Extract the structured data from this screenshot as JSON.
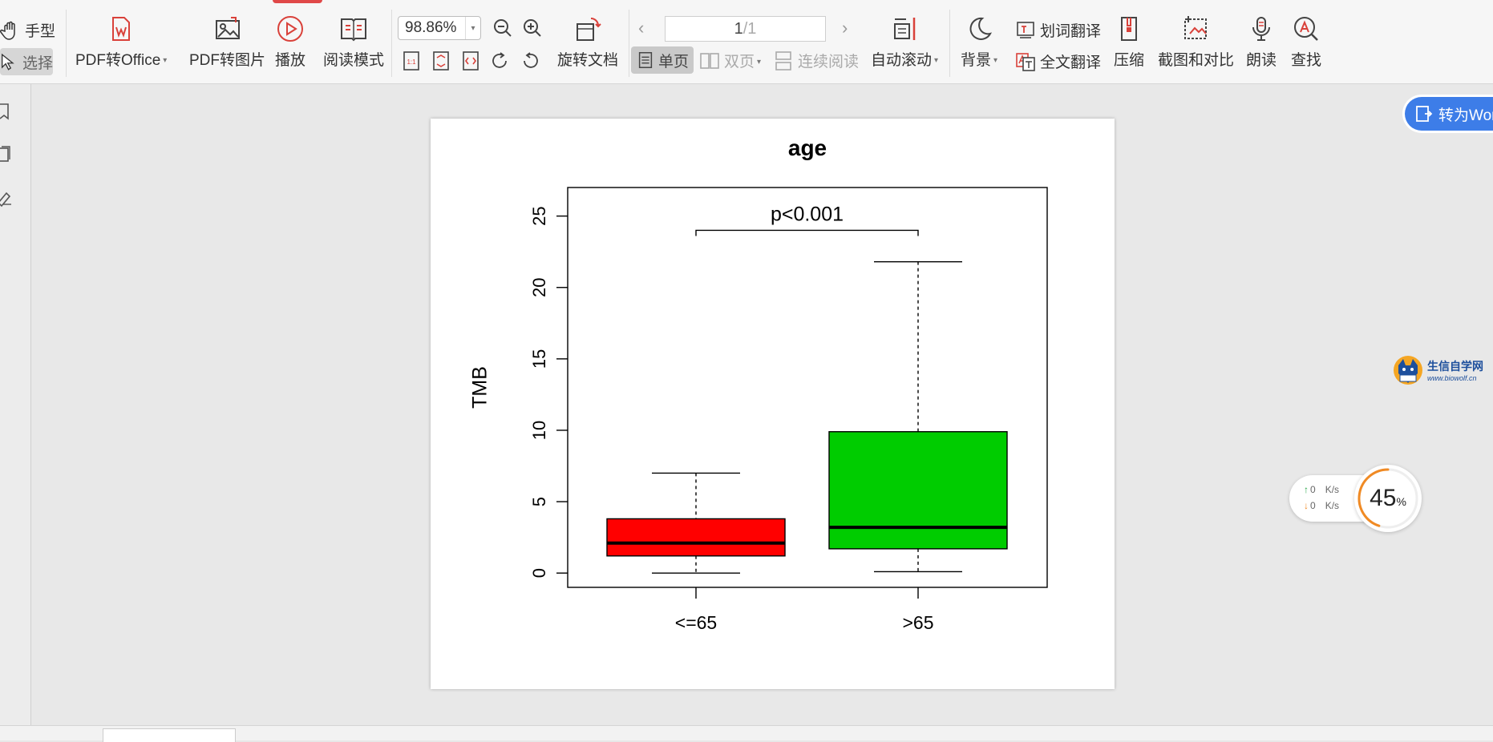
{
  "toolbar": {
    "hand_label": "手型",
    "select_label": "选择",
    "pdf_to_office": "PDF转Office",
    "pdf_to_image": "PDF转图片",
    "play": "播放",
    "reading_mode": "阅读模式",
    "zoom_value": "98.86%",
    "rotate_doc": "旋转文档",
    "page_current": "1",
    "page_total": "/1",
    "single_page": "单页",
    "double_page": "双页",
    "continuous_read": "连续阅读",
    "auto_scroll": "自动滚动",
    "background": "背景",
    "word_translate": "划词翻译",
    "full_translate": "全文翻译",
    "compress": "压缩",
    "screenshot_compare": "截图和对比",
    "read_aloud": "朗读",
    "find": "查找",
    "fit_page_icon_text": "1:1"
  },
  "floating": {
    "to_word": "转为Wor",
    "watermark_cn": "生信自学网",
    "watermark_url": "www.biowolf.cn",
    "upload_speed": "0",
    "download_speed": "0",
    "speed_unit": "K/s",
    "progress_percent": "45",
    "progress_sign": "%",
    "progress_fraction": 0.45
  },
  "colors": {
    "accent_blue": "#3d7de8",
    "box_red": "#ff0000",
    "box_green": "#00cc00",
    "gauge_orange": "#f08a24"
  },
  "chart_data": {
    "type": "boxplot",
    "title": "age",
    "xlabel": "",
    "ylabel": "TMB",
    "ylim": [
      0,
      27
    ],
    "yticks": [
      0,
      5,
      10,
      15,
      20,
      25
    ],
    "categories": [
      "<=65",
      ">65"
    ],
    "boxes": [
      {
        "label": "<=65",
        "min": 0.0,
        "q1": 1.2,
        "median": 2.1,
        "q3": 3.8,
        "max": 7.0,
        "color": "#ff0000"
      },
      {
        "label": ">65",
        "min": 0.1,
        "q1": 1.7,
        "median": 3.2,
        "q3": 9.9,
        "max": 21.8,
        "color": "#00cc00"
      }
    ],
    "annotation": {
      "text": "p<0.001",
      "y": 24.0
    },
    "grid": false,
    "legend": "none"
  }
}
